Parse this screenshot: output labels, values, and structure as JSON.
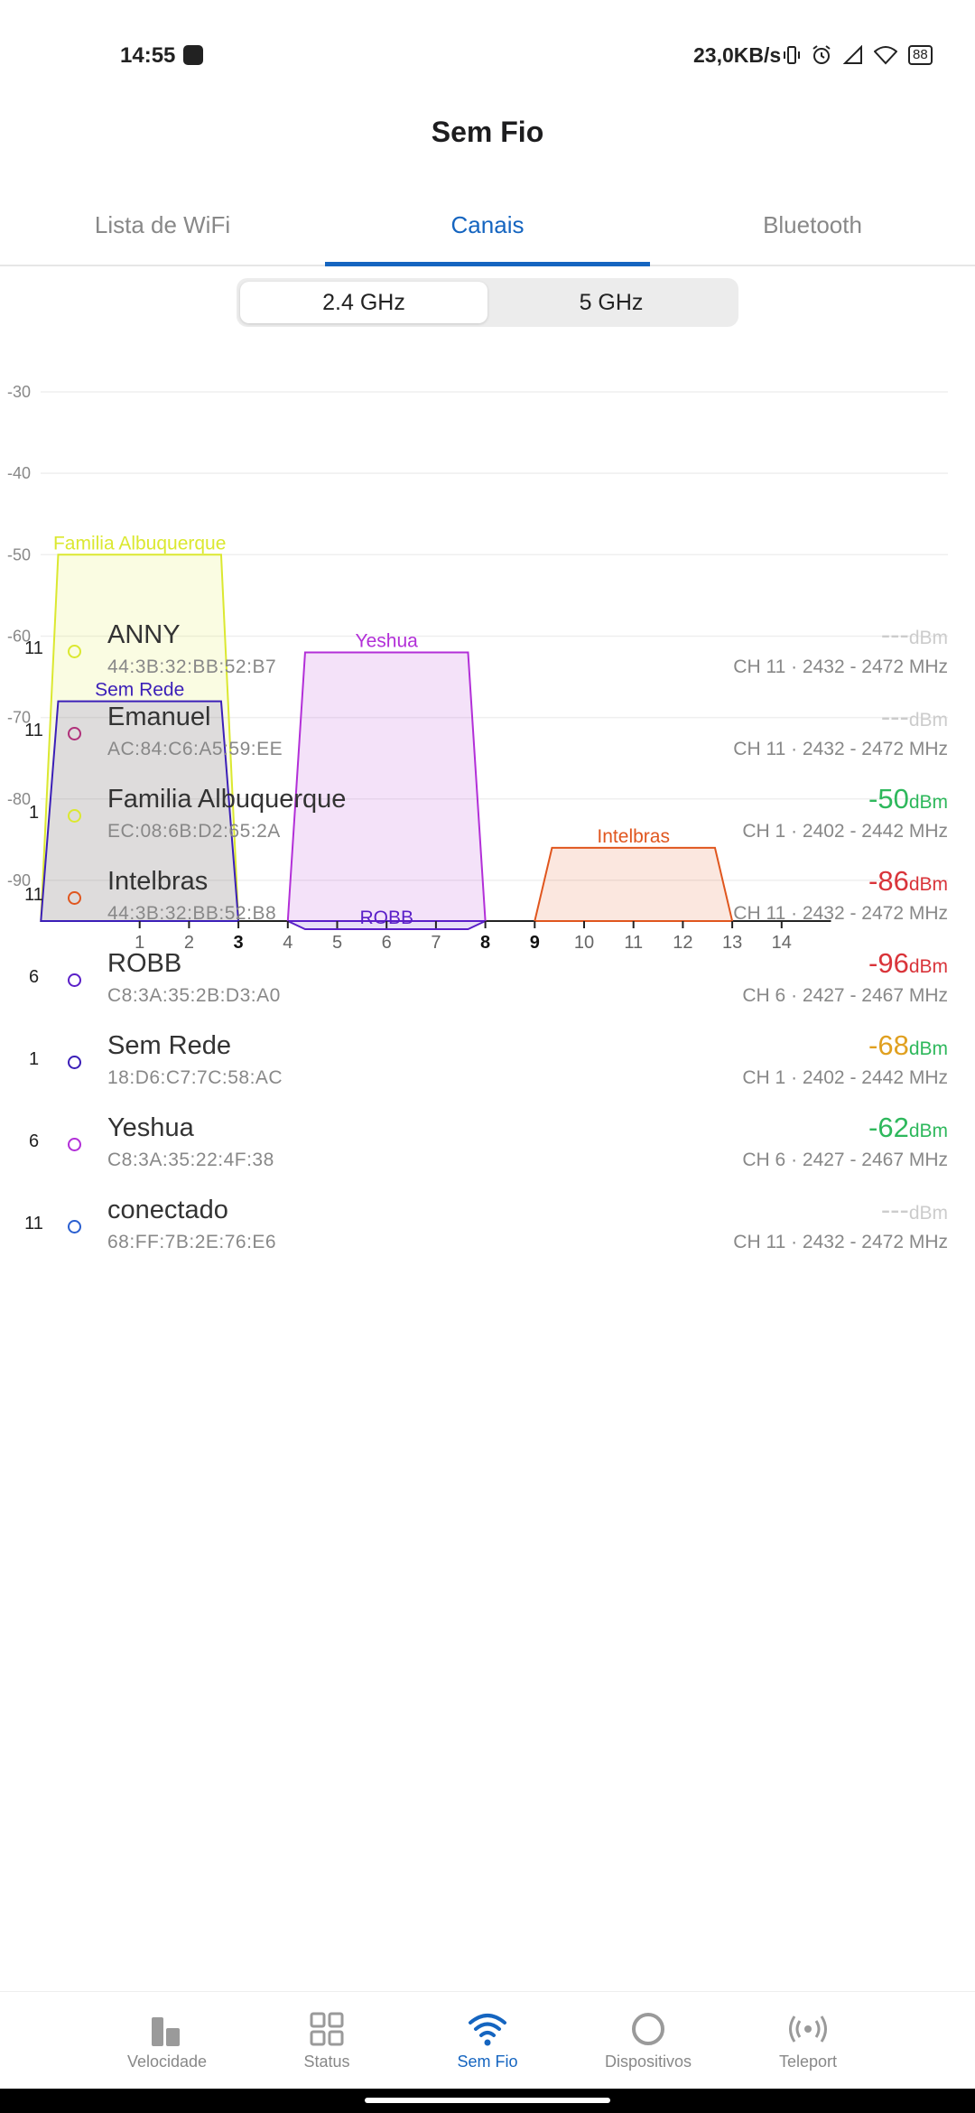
{
  "status_bar": {
    "time": "14:55",
    "speed": "23,0KB/s",
    "battery": "88",
    "icons": [
      "vibrate-icon",
      "alarm-icon",
      "signal-icon",
      "wifi-icon",
      "battery-icon"
    ]
  },
  "header": {
    "title": "Sem Fio"
  },
  "tabs": [
    {
      "label": "Lista de WiFi",
      "active": false
    },
    {
      "label": "Canais",
      "active": true
    },
    {
      "label": "Bluetooth",
      "active": false
    }
  ],
  "band_toggle": {
    "options": [
      "2.4 GHz",
      "5 GHz"
    ],
    "selected": "2.4 GHz"
  },
  "chart_data": {
    "type": "area",
    "ylim": [
      -95,
      -30
    ],
    "y_ticks": [
      -30,
      -40,
      -50,
      -60,
      -70,
      -80,
      -90
    ],
    "x_ticks": [
      "1",
      "2",
      "3",
      "4",
      "5",
      "6",
      "7",
      "8",
      "9",
      "10",
      "11",
      "12",
      "13",
      "14"
    ],
    "x_ticks_bold": [
      "3",
      "8",
      "9"
    ],
    "networks": [
      {
        "name": "Familia Albuquerque",
        "channel": 1,
        "signal": -50,
        "color": "#dbe830"
      },
      {
        "name": "Sem Rede",
        "channel": 1,
        "signal": -68,
        "color": "#3b1fb8"
      },
      {
        "name": "Yeshua",
        "channel": 6,
        "signal": -62,
        "color": "#b22fd8"
      },
      {
        "name": "Intelbras",
        "channel": 11,
        "signal": -86,
        "color": "#e0561e"
      },
      {
        "name": "ROBB",
        "channel": 6,
        "signal": -96,
        "color": "#5a1fc8"
      }
    ]
  },
  "network_list": [
    {
      "channel": "11",
      "name": "ANNY",
      "mac": "44:3B:32:BB:52:B7",
      "signal": "---",
      "unit": "dBm",
      "freq": "CH 11 · 2432 - 2472 MHz",
      "dot_color": "#dbe830",
      "signal_color": "#cccccc"
    },
    {
      "channel": "11",
      "name": "Emanuel",
      "mac": "AC:84:C6:A5:59:EE",
      "signal": "---",
      "unit": "dBm",
      "freq": "CH 11 · 2432 - 2472 MHz",
      "dot_color": "#b0307a",
      "signal_color": "#cccccc"
    },
    {
      "channel": "1",
      "name": "Familia Albuquerque",
      "mac": "EC:08:6B:D2:65:2A",
      "signal": "-50",
      "unit": "dBm",
      "freq": "CH 1 · 2402 - 2442 MHz",
      "dot_color": "#dbe830",
      "signal_color": "#2eb85c"
    },
    {
      "channel": "11",
      "name": "Intelbras",
      "mac": "44:3B:32:BB:52:B8",
      "signal": "-86",
      "unit": "dBm",
      "freq": "CH 11 · 2432 - 2472 MHz",
      "dot_color": "#e0561e",
      "signal_color": "#d9343a"
    },
    {
      "channel": "6",
      "name": "ROBB",
      "mac": "C8:3A:35:2B:D3:A0",
      "signal": "-96",
      "unit": "dBm",
      "freq": "CH 6 · 2427 - 2467 MHz",
      "dot_color": "#5a1fc8",
      "signal_color": "#d9343a"
    },
    {
      "channel": "1",
      "name": "Sem Rede",
      "mac": "18:D6:C7:7C:58:AC",
      "signal": "-68",
      "unit": "dBm",
      "freq": "CH 1 · 2402 - 2442 MHz",
      "dot_color": "#3b1fb8",
      "signal_color": "#e0a020"
    },
    {
      "channel": "6",
      "name": "Yeshua",
      "mac": "C8:3A:35:22:4F:38",
      "signal": "-62",
      "unit": "dBm",
      "freq": "CH 6 · 2427 - 2467 MHz",
      "dot_color": "#b22fd8",
      "signal_color": "#2eb85c"
    },
    {
      "channel": "11",
      "name": "conectado",
      "mac": "68:FF:7B:2E:76:E6",
      "signal": "---",
      "unit": "dBm",
      "freq": "CH 11 · 2432 - 2472 MHz",
      "dot_color": "#2a5fd0",
      "signal_color": "#cccccc"
    }
  ],
  "bottom_nav": [
    {
      "label": "Velocidade",
      "icon": "speed-bars-icon",
      "active": false
    },
    {
      "label": "Status",
      "icon": "grid-icon",
      "active": false
    },
    {
      "label": "Sem Fio",
      "icon": "wifi-icon",
      "active": true
    },
    {
      "label": "Dispositivos",
      "icon": "circle-icon",
      "active": false
    },
    {
      "label": "Teleport",
      "icon": "teleport-icon",
      "active": false
    }
  ],
  "colors": {
    "accent": "#1565c0",
    "text_secondary": "#888888"
  }
}
